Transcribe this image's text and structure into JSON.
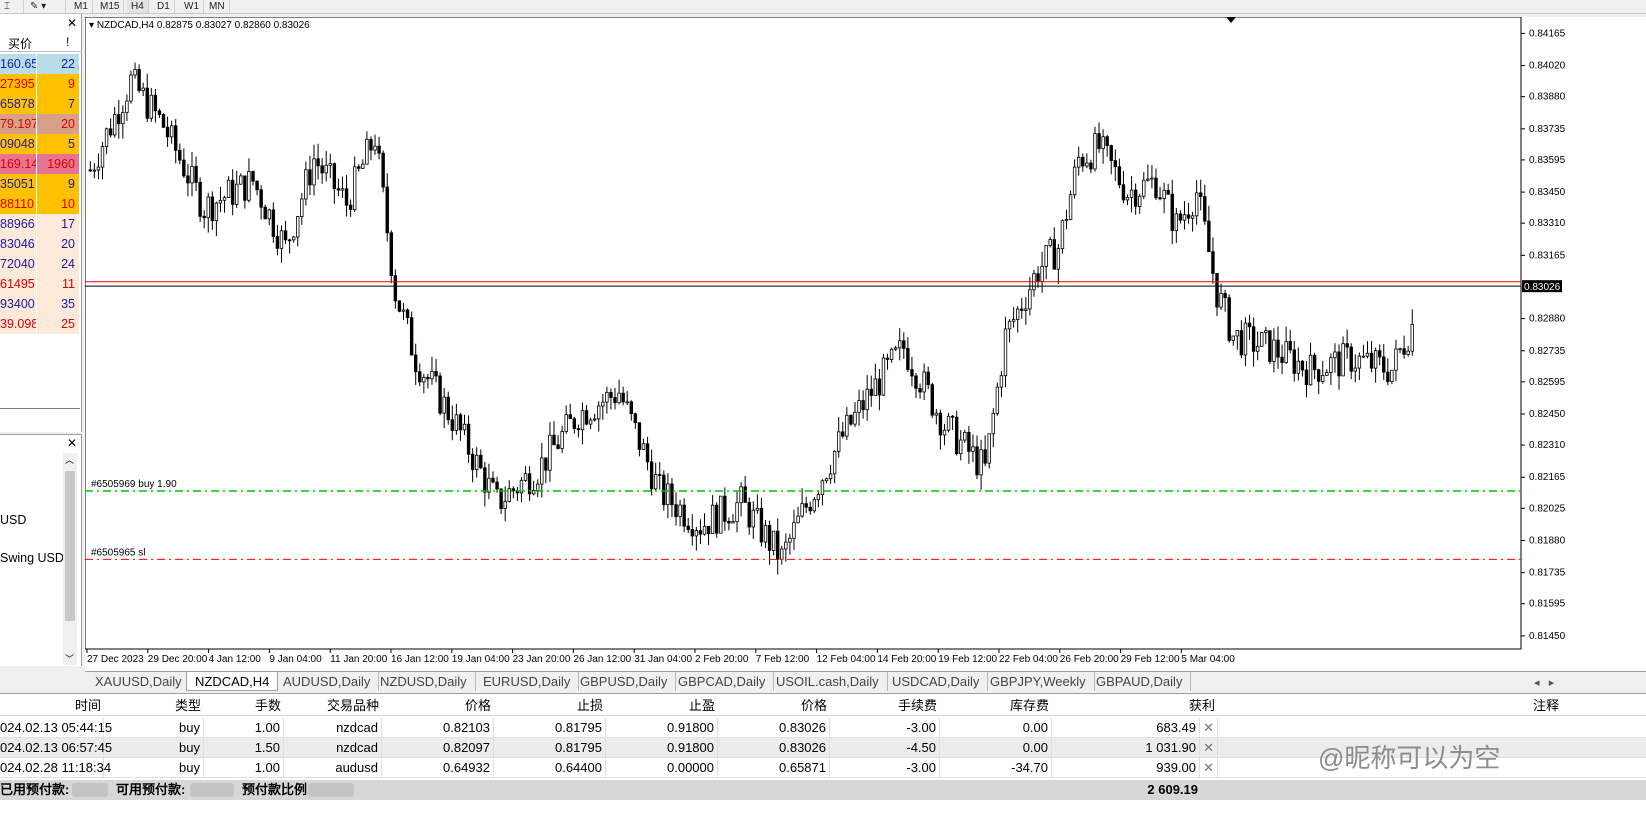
{
  "toolbar": {
    "timeframes": [
      "M1",
      "M15",
      "H4",
      "D1",
      "W1",
      "MN"
    ],
    "active_timeframe": "H4"
  },
  "market_watch": {
    "header_bid": "买价",
    "header_spread": "!",
    "rows": [
      {
        "price": "160.65",
        "spread": "22",
        "bg": "#b7dde8",
        "color": "#1a1aa6"
      },
      {
        "price": "27395",
        "spread": "9",
        "bg": "#ffc000",
        "color": "#e00000"
      },
      {
        "price": "65878",
        "spread": "7",
        "bg": "#ffc000",
        "color": "#1a1aa6"
      },
      {
        "price": "79.197",
        "spread": "20",
        "bg": "#d9a088",
        "color": "#e00000"
      },
      {
        "price": "09048",
        "spread": "5",
        "bg": "#ffc000",
        "color": "#1a1aa6"
      },
      {
        "price": "169.14",
        "spread": "1960",
        "bg": "#e87590",
        "color": "#e00000"
      },
      {
        "price": "35051",
        "spread": "9",
        "bg": "#ffc000",
        "color": "#1a1aa6"
      },
      {
        "price": "88110",
        "spread": "10",
        "bg": "#ffc000",
        "color": "#e00000"
      },
      {
        "price": "88966",
        "spread": "17",
        "bg": "#fde9d9",
        "color": "#1a1aa6"
      },
      {
        "price": "83046",
        "spread": "20",
        "bg": "#fde9d9",
        "color": "#1a1aa6"
      },
      {
        "price": "72040",
        "spread": "24",
        "bg": "#fde9d9",
        "color": "#1a1aa6"
      },
      {
        "price": "61495",
        "spread": "11",
        "bg": "#fde9d9",
        "color": "#e00000"
      },
      {
        "price": "93400",
        "spread": "35",
        "bg": "#fde9d9",
        "color": "#1a1aa6"
      },
      {
        "price": "39.098",
        "spread": "25",
        "bg": "#fde9d9",
        "color": "#e00000"
      }
    ]
  },
  "navigator": {
    "items": [
      "USD",
      "Swing USD"
    ]
  },
  "chart": {
    "title": "NZDCAD,H4  0.82875 0.83027 0.82860 0.83026",
    "current_price_label": "0.83026",
    "buy_line_label": "#6505969 buy 1.90",
    "sl_line_label": "#6505965 sl",
    "y_ticks": [
      "0.84165",
      "0.84020",
      "0.83880",
      "0.83735",
      "0.83595",
      "0.83450",
      "0.83310",
      "0.83165",
      "0.82880",
      "0.82735",
      "0.82595",
      "0.82450",
      "0.82310",
      "0.82165",
      "0.82025",
      "0.81880",
      "0.81735",
      "0.81595",
      "0.81450"
    ],
    "x_ticks": [
      "27 Dec 2023",
      "29 Dec 20:00",
      "4 Jan 12:00",
      "9 Jan 04:00",
      "11 Jan 20:00",
      "16 Jan 12:00",
      "19 Jan 04:00",
      "23 Jan 20:00",
      "26 Jan 12:00",
      "31 Jan 04:00",
      "2 Feb 20:00",
      "7 Feb 12:00",
      "12 Feb 04:00",
      "14 Feb 20:00",
      "19 Feb 12:00",
      "22 Feb 04:00",
      "26 Feb 20:00",
      "29 Feb 12:00",
      "5 Mar 04:00"
    ],
    "colors": {
      "bid_line": "#ff0000",
      "buy_line": "#00c000",
      "sl_line": "#ff0000",
      "candles": "#000000"
    }
  },
  "tabs": [
    "XAUUSD,Daily",
    "NZDCAD,H4",
    "AUDUSD,Daily",
    "NZDUSD,Daily",
    "EURUSD,Daily",
    "GBPUSD,Daily",
    "GBPCAD,Daily",
    "USOIL.cash,Daily",
    "USDCAD,Daily",
    "GBPJPY,Weekly",
    "GBPAUD,Daily"
  ],
  "active_tab": "NZDCAD,H4",
  "terminal": {
    "headers": {
      "time": "时间",
      "type": "类型",
      "lots": "手数",
      "symbol": "交易品种",
      "price": "价格",
      "sl": "止损",
      "tp": "止盈",
      "cur_price": "价格",
      "commission": "手续费",
      "swap": "库存费",
      "profit": "获利",
      "comment": "注释"
    },
    "rows": [
      {
        "time": "024.02.13 05:44:15",
        "type": "buy",
        "lots": "1.00",
        "symbol": "nzdcad",
        "price": "0.82103",
        "sl": "0.81795",
        "tp": "0.91800",
        "cur_price": "0.83026",
        "commission": "-3.00",
        "swap": "0.00",
        "profit": "683.49"
      },
      {
        "time": "024.02.13 06:57:45",
        "type": "buy",
        "lots": "1.50",
        "symbol": "nzdcad",
        "price": "0.82097",
        "sl": "0.81795",
        "tp": "0.91800",
        "cur_price": "0.83026",
        "commission": "-4.50",
        "swap": "0.00",
        "profit": "1 031.90"
      },
      {
        "time": "024.02.28 11:18:34",
        "type": "buy",
        "lots": "1.00",
        "symbol": "audusd",
        "price": "0.64932",
        "sl": "0.64400",
        "tp": "0.00000",
        "cur_price": "0.65871",
        "commission": "-3.00",
        "swap": "-34.70",
        "profit": "939.00"
      }
    ],
    "summary": {
      "used_margin": "已用预付款:",
      "free_margin": "可用预付款:",
      "margin_level": "预付款比例:",
      "total_profit": "2 609.19"
    }
  },
  "watermark": "@昵称可以为空"
}
